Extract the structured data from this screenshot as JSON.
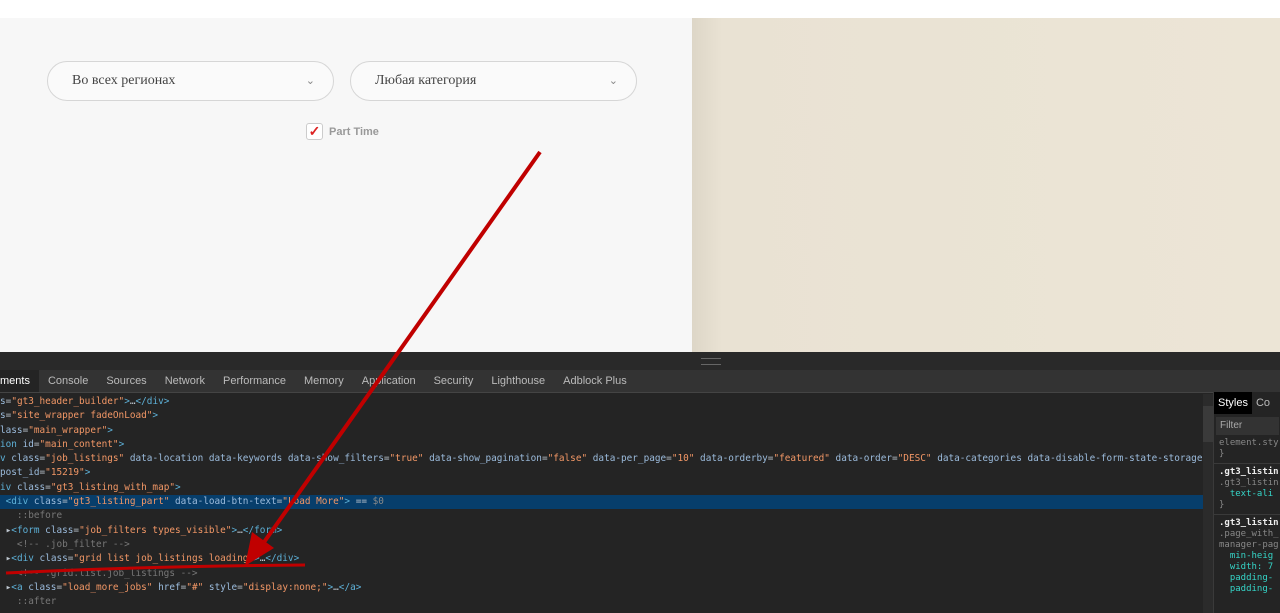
{
  "page": {
    "region_select": "Во всех регионах",
    "category_select": "Любая категория",
    "part_time_label": "Part Time",
    "part_time_checked": true
  },
  "devtools": {
    "tabs": [
      "ments",
      "Console",
      "Sources",
      "Network",
      "Performance",
      "Memory",
      "Application",
      "Security",
      "Lighthouse",
      "Adblock Plus"
    ],
    "styles_tabs": [
      "Styles",
      "Co"
    ],
    "filter_placeholder": "Filter",
    "styles_lines": [
      "element.sty",
      "}",
      ".gt3_listin",
      ".gt3_listin",
      "  text-ali",
      "}",
      ".gt3_listin",
      ".page_with_",
      "manager-pag",
      "  min-heig",
      "  width: 7",
      "  padding-",
      "  padding-"
    ]
  },
  "colors": {
    "annotation": "#c00000",
    "selected_row": "#073e6b"
  }
}
